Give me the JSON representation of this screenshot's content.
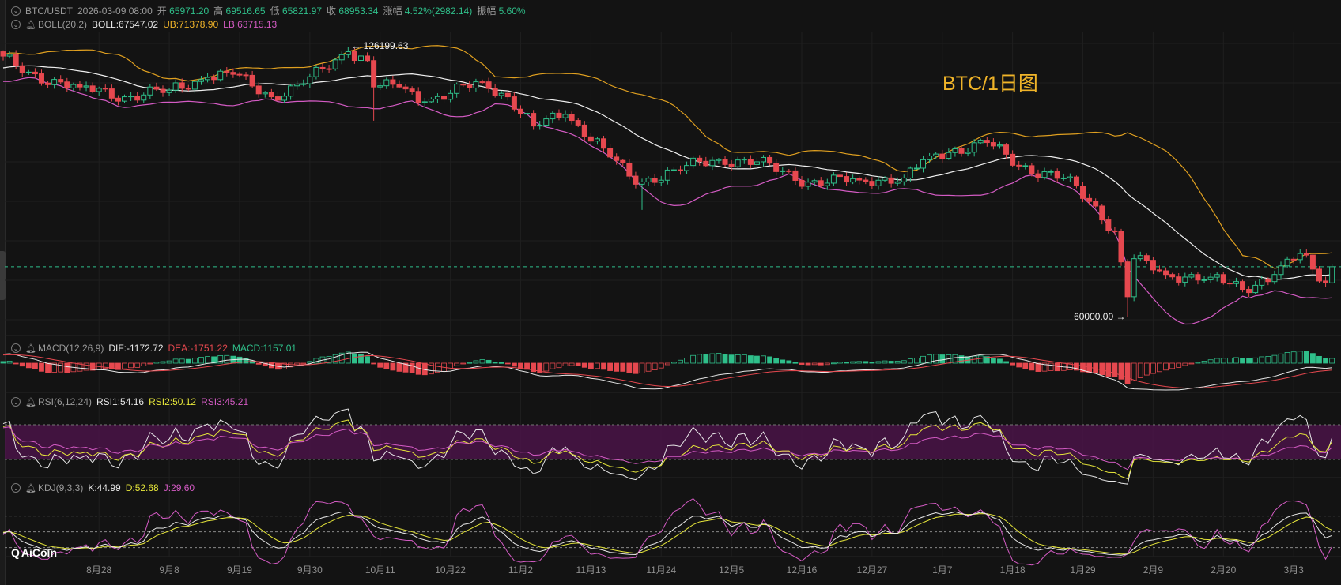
{
  "header": {
    "symbol": "BTC/USDT",
    "datetime": "2026-03-09 08:00",
    "open_label": "开",
    "open": "65971.20",
    "high_label": "高",
    "high": "69516.65",
    "low_label": "低",
    "low": "65821.97",
    "close_label": "收",
    "close": "68953.34",
    "change_label": "涨幅",
    "change": "4.52%(2982.14)",
    "amplitude_label": "振幅",
    "amplitude": "5.60%"
  },
  "boll": {
    "name": "BOLL(20,2)",
    "mid": "BOLL:67547.02",
    "ub": "UB:71378.90",
    "lb": "LB:63715.13"
  },
  "macd": {
    "name": "MACD(12,26,9)",
    "dif": "DIF:-1172.72",
    "dea": "DEA:-1751.22",
    "macd": "MACD:1157.01"
  },
  "rsi": {
    "name": "RSI(6,12,24)",
    "rsi1": "RSI1:54.16",
    "rsi2": "RSI2:50.12",
    "rsi3": "RSI3:45.21"
  },
  "kdj": {
    "name": "KDJ(9,3,3)",
    "k": "K:44.99",
    "d": "D:52.68",
    "j": "J:29.60"
  },
  "chart_title": "BTC/1日图",
  "logo_text": "AiCoin",
  "max_marker": "126199.63",
  "min_marker": "60000.00",
  "colors": {
    "up": "#2fbf8a",
    "down": "#e6484f",
    "boll_mid": "#f0f0f0",
    "boll_ub": "#e0a020",
    "boll_lb": "#d45bc4",
    "rsi_band": "#4a1448",
    "title": "#f0b429",
    "background": "#131313"
  },
  "chart_data": {
    "type": "candlestick",
    "interval": "1D",
    "y_scale": "log",
    "grid": true,
    "close_anchors": [
      {
        "date": "2025-08-13",
        "close": 123000
      },
      {
        "date": "2025-08-16",
        "close": 117500
      },
      {
        "date": "2025-08-25",
        "close": 113000
      },
      {
        "date": "2025-09-01",
        "close": 110000
      },
      {
        "date": "2025-09-08",
        "close": 112000
      },
      {
        "date": "2025-09-14",
        "close": 116000
      },
      {
        "date": "2025-09-18",
        "close": 117000
      },
      {
        "date": "2025-09-24",
        "close": 110000
      },
      {
        "date": "2025-09-29",
        "close": 114000
      },
      {
        "date": "2025-10-06",
        "close": 124500
      },
      {
        "date": "2025-10-09",
        "close": 121500
      },
      {
        "date": "2025-10-10",
        "close": 113000
      },
      {
        "date": "2025-10-14",
        "close": 113000
      },
      {
        "date": "2025-10-18",
        "close": 108500
      },
      {
        "date": "2025-10-27",
        "close": 114600
      },
      {
        "date": "2025-10-31",
        "close": 110000
      },
      {
        "date": "2025-11-04",
        "close": 101500
      },
      {
        "date": "2025-11-09",
        "close": 104800
      },
      {
        "date": "2025-11-15",
        "close": 95500
      },
      {
        "date": "2025-11-20",
        "close": 86500
      },
      {
        "date": "2025-11-26",
        "close": 90000
      },
      {
        "date": "2025-12-03",
        "close": 92600
      },
      {
        "date": "2025-12-09",
        "close": 92000
      },
      {
        "date": "2025-12-17",
        "close": 87000
      },
      {
        "date": "2025-12-25",
        "close": 87500
      },
      {
        "date": "2026-01-01",
        "close": 88000
      },
      {
        "date": "2026-01-05",
        "close": 93500
      },
      {
        "date": "2026-01-14",
        "close": 97000
      },
      {
        "date": "2026-01-19",
        "close": 91000
      },
      {
        "date": "2026-01-26",
        "close": 88000
      },
      {
        "date": "2026-01-30",
        "close": 82500
      },
      {
        "date": "2026-02-03",
        "close": 76000
      },
      {
        "date": "2026-02-05",
        "close": 63500
      },
      {
        "date": "2026-02-06",
        "close": 70500
      },
      {
        "date": "2026-02-11",
        "close": 67500
      },
      {
        "date": "2026-02-18",
        "close": 67000
      },
      {
        "date": "2026-02-23",
        "close": 64800
      },
      {
        "date": "2026-02-28",
        "close": 67500
      },
      {
        "date": "2026-03-04",
        "close": 71500
      },
      {
        "date": "2026-03-06",
        "close": 68500
      },
      {
        "date": "2026-03-08",
        "close": 65971.2
      },
      {
        "date": "2026-03-09",
        "close": 68953.34
      }
    ],
    "extremes": {
      "high": {
        "date": "2025-10-06",
        "value": 126199.63
      },
      "low": {
        "date": "2026-02-05",
        "value": 60000.0
      }
    },
    "last_candle": {
      "date": "2026-03-09",
      "open": 65971.2,
      "high": 69516.65,
      "low": 65821.97,
      "close": 68953.34
    },
    "x_ticks": [
      "8月28",
      "9月8",
      "9月19",
      "9月30",
      "10月11",
      "10月22",
      "11月2",
      "11月13",
      "11月24",
      "12月5",
      "12月16",
      "12月27",
      "1月7",
      "1月18",
      "1月29",
      "2月9",
      "2月20",
      "3月3"
    ],
    "rsi_band": [
      30,
      70
    ],
    "kdj_levels": [
      20,
      50,
      80
    ]
  }
}
